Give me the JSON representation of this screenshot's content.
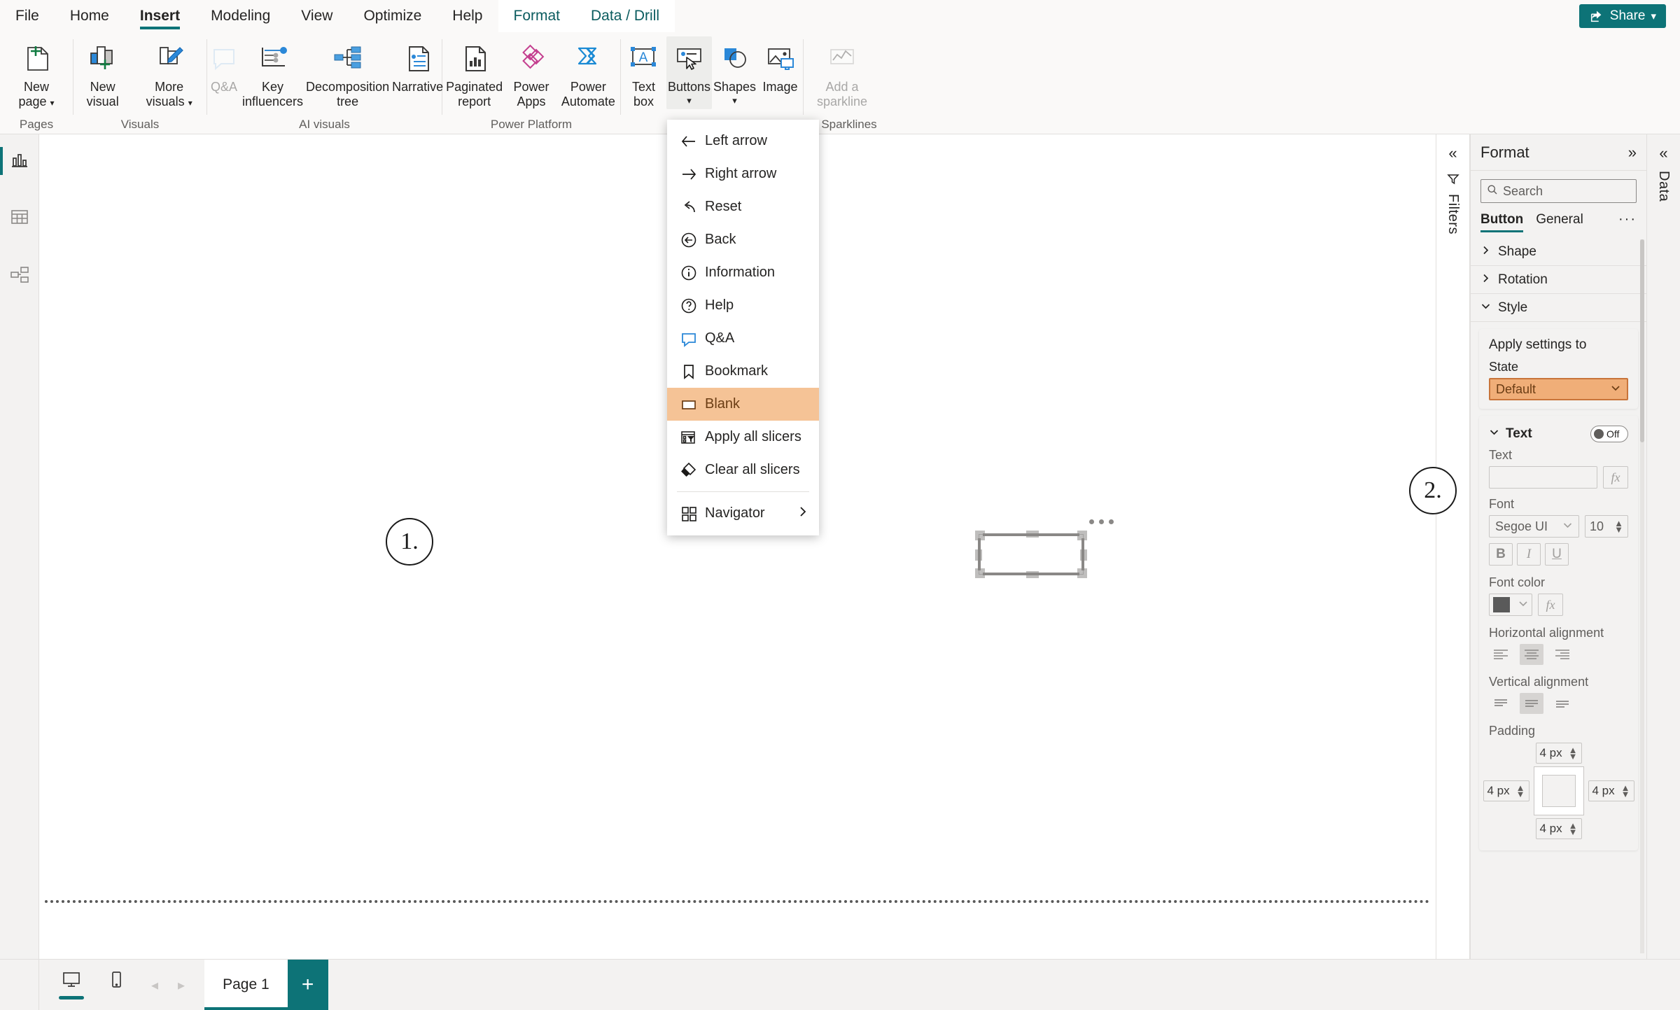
{
  "app": {
    "ribbon_tabs": [
      {
        "label": "File",
        "selected": false,
        "contextual": false
      },
      {
        "label": "Home",
        "selected": false,
        "contextual": false
      },
      {
        "label": "Insert",
        "selected": true,
        "contextual": false
      },
      {
        "label": "Modeling",
        "selected": false,
        "contextual": false
      },
      {
        "label": "View",
        "selected": false,
        "contextual": false
      },
      {
        "label": "Optimize",
        "selected": false,
        "contextual": false
      },
      {
        "label": "Help",
        "selected": false,
        "contextual": false
      },
      {
        "label": "Format",
        "selected": false,
        "contextual": true
      },
      {
        "label": "Data / Drill",
        "selected": false,
        "contextual": true
      }
    ],
    "share_label": "Share",
    "accent_color": "#0d7377",
    "highlight_color": "#f5c396"
  },
  "ribbon": {
    "groups": [
      {
        "label": "Pages",
        "items": [
          {
            "icon": "new-page-icon",
            "caption": "New\npage",
            "caret": true,
            "disabled": false
          }
        ]
      },
      {
        "label": "Visuals",
        "items": [
          {
            "icon": "new-visual-icon",
            "caption": "New\nvisual",
            "caret": false,
            "disabled": false
          },
          {
            "icon": "more-visuals-icon",
            "caption": "More\nvisuals",
            "caret": true,
            "disabled": false
          }
        ]
      },
      {
        "label": "AI visuals",
        "items": [
          {
            "icon": "qanda-icon",
            "caption": "Q&A",
            "caret": false,
            "disabled": true
          },
          {
            "icon": "key-influencers-icon",
            "caption": "Key\ninfluencers",
            "caret": false,
            "disabled": false
          },
          {
            "icon": "decomposition-tree-icon",
            "caption": "Decomposition\ntree",
            "caret": false,
            "disabled": false
          },
          {
            "icon": "narrative-icon",
            "caption": "Narrative",
            "caret": false,
            "disabled": false
          }
        ]
      },
      {
        "label": "Power Platform",
        "items": [
          {
            "icon": "paginated-report-icon",
            "caption": "Paginated\nreport",
            "caret": false,
            "disabled": false
          },
          {
            "icon": "power-apps-icon",
            "caption": "Power\nApps",
            "caret": false,
            "disabled": false
          },
          {
            "icon": "power-automate-icon",
            "caption": "Power\nAutomate",
            "caret": false,
            "disabled": false
          }
        ]
      },
      {
        "label": "",
        "items": [
          {
            "icon": "text-box-icon",
            "caption": "Text\nbox",
            "caret": false,
            "disabled": false
          },
          {
            "icon": "buttons-icon",
            "caption": "Buttons",
            "caret": true,
            "disabled": false,
            "active": true
          },
          {
            "icon": "shapes-icon",
            "caption": "Shapes",
            "caret": true,
            "disabled": false
          },
          {
            "icon": "image-icon",
            "caption": "Image",
            "caret": false,
            "disabled": false
          }
        ]
      },
      {
        "label": "Sparklines",
        "items": [
          {
            "icon": "add-sparkline-icon",
            "caption": "Add a\nsparkline",
            "caret": false,
            "disabled": true
          }
        ]
      }
    ]
  },
  "left_rail": {
    "items": [
      {
        "icon": "report-view-icon",
        "name": "report-view",
        "selected": true
      },
      {
        "icon": "table-view-icon",
        "name": "table-view",
        "selected": false
      },
      {
        "icon": "model-view-icon",
        "name": "model-view",
        "selected": false
      }
    ]
  },
  "buttons_menu": {
    "items": [
      {
        "label": "Left arrow",
        "icon": "left-arrow-icon",
        "highlight": false,
        "submenu": false
      },
      {
        "label": "Right arrow",
        "icon": "right-arrow-icon",
        "highlight": false,
        "submenu": false
      },
      {
        "label": "Reset",
        "icon": "reset-icon",
        "highlight": false,
        "submenu": false
      },
      {
        "label": "Back",
        "icon": "back-icon",
        "highlight": false,
        "submenu": false
      },
      {
        "label": "Information",
        "icon": "information-icon",
        "highlight": false,
        "submenu": false
      },
      {
        "label": "Help",
        "icon": "help-icon",
        "highlight": false,
        "submenu": false
      },
      {
        "label": "Q&A",
        "icon": "qanda-bubble-icon",
        "highlight": false,
        "submenu": false
      },
      {
        "label": "Bookmark",
        "icon": "bookmark-icon",
        "highlight": false,
        "submenu": false
      },
      {
        "label": "Blank",
        "icon": "blank-rect-icon",
        "highlight": true,
        "submenu": false
      },
      {
        "label": "Apply all slicers",
        "icon": "apply-all-slicers-icon",
        "highlight": false,
        "submenu": false
      },
      {
        "label": "Clear all slicers",
        "icon": "clear-all-slicers-icon",
        "highlight": false,
        "submenu": false
      },
      {
        "label": "Navigator",
        "icon": "navigator-icon",
        "highlight": false,
        "submenu": true,
        "separator_before": true
      }
    ]
  },
  "annotations": [
    {
      "label": "1."
    },
    {
      "label": "2."
    }
  ],
  "filters": {
    "label": "Filters"
  },
  "data_rail": {
    "label": "Data"
  },
  "format_pane": {
    "title": "Format",
    "search_placeholder": "Search",
    "tabs": [
      {
        "label": "Button",
        "selected": true
      },
      {
        "label": "General",
        "selected": false
      }
    ],
    "more_label": "···",
    "accordions": [
      {
        "label": "Shape",
        "expanded": false
      },
      {
        "label": "Rotation",
        "expanded": false
      },
      {
        "label": "Style",
        "expanded": true
      }
    ],
    "apply_settings": {
      "title": "Apply settings to",
      "state_label": "State",
      "state_value": "Default"
    },
    "text_section": {
      "title": "Text",
      "toggle_label": "Off",
      "text_label": "Text",
      "text_value": "",
      "font_label": "Font",
      "font_family": "Segoe UI",
      "font_size": "10",
      "bold_label": "B",
      "italic_label": "I",
      "underline_label": "U",
      "font_color_label": "Font color",
      "font_color_value": "#5a5a5a",
      "horizontal_alignment_label": "Horizontal alignment",
      "horizontal_alignment_value": "center",
      "vertical_alignment_label": "Vertical alignment",
      "vertical_alignment_value": "middle",
      "padding_label": "Padding",
      "padding_top": "4 px",
      "padding_left": "4 px",
      "padding_right": "4 px",
      "padding_bottom": "4 px"
    }
  },
  "bottom_bar": {
    "views": [
      {
        "icon": "desktop-view-icon",
        "name": "desktop-layout",
        "selected": true
      },
      {
        "icon": "mobile-view-icon",
        "name": "mobile-layout",
        "selected": false
      }
    ],
    "prev_label": "◂",
    "next_label": "▸",
    "pages": [
      {
        "label": "Page 1",
        "selected": true
      }
    ],
    "add_page_label": "+"
  }
}
